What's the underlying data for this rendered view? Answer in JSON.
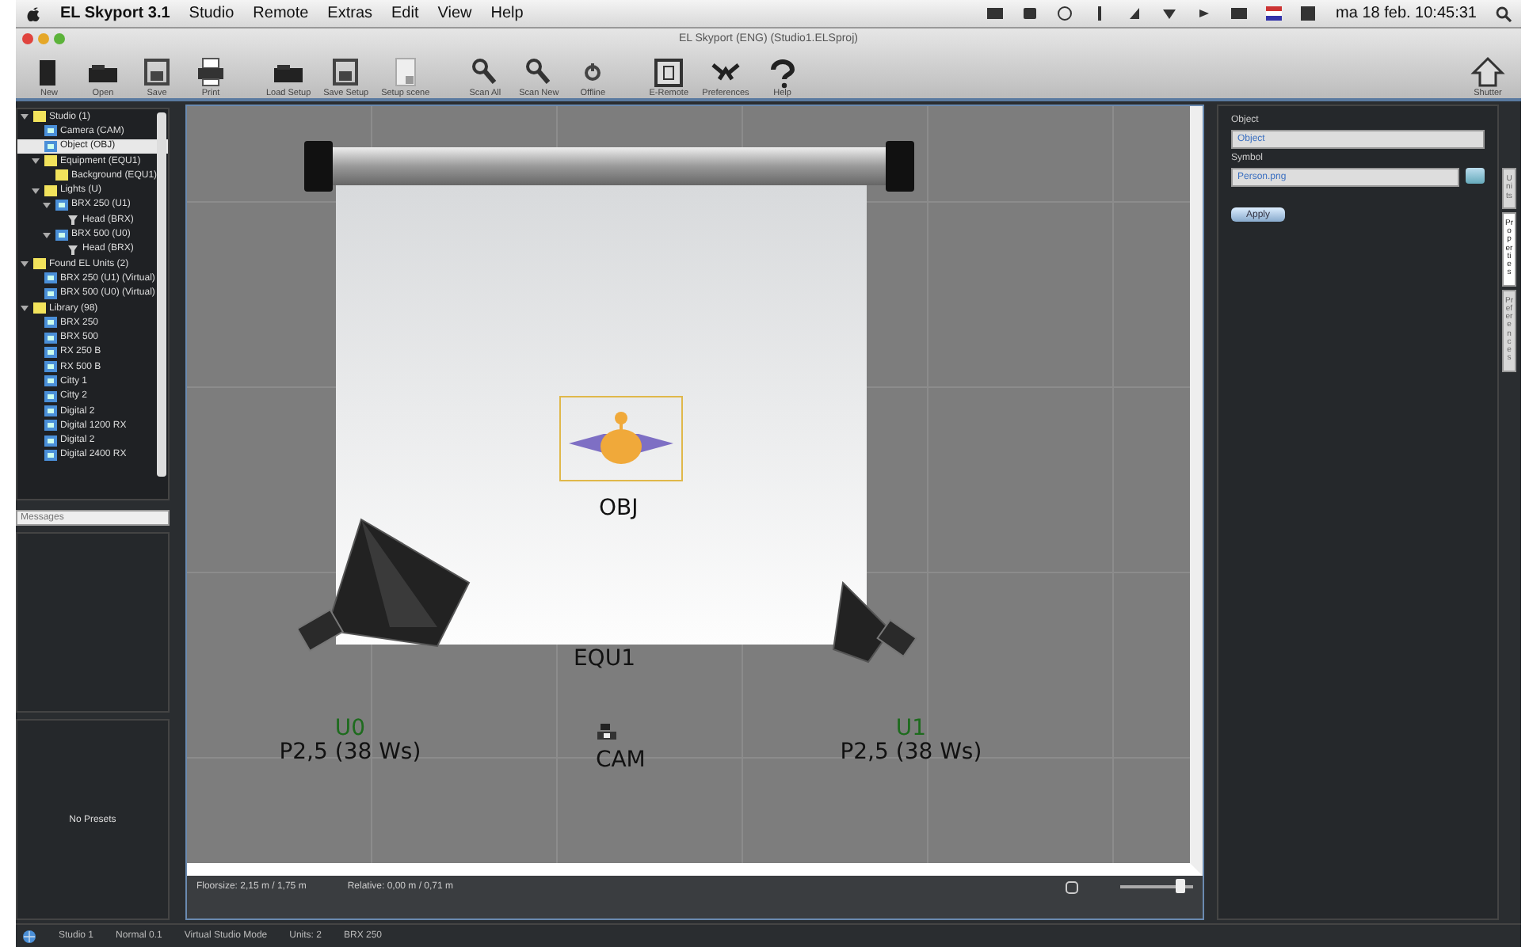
{
  "menu_bar": {
    "items": [
      "EL Skyport 3.1",
      "Studio",
      "Remote",
      "Extras",
      "Edit",
      "View",
      "Help"
    ],
    "clock": "ma 18 feb. 10:45:31"
  },
  "window": {
    "title": "EL Skyport (ENG) (Studio1.ELSproj)"
  },
  "toolbar": {
    "buttons": [
      {
        "label": "New",
        "kind": "new"
      },
      {
        "label": "Open",
        "kind": "open"
      },
      {
        "label": "Save",
        "kind": "save"
      },
      {
        "label": "Print",
        "kind": "print"
      },
      {
        "label": "Load Setup",
        "kind": "open"
      },
      {
        "label": "Save Setup",
        "kind": "save"
      },
      {
        "label": "Setup scene",
        "kind": "scene"
      },
      {
        "label": "Scan All",
        "kind": "scan"
      },
      {
        "label": "Scan New",
        "kind": "scan"
      },
      {
        "label": "Offline",
        "kind": "offline"
      },
      {
        "label": "E-Remote",
        "kind": "remote"
      },
      {
        "label": "Preferences",
        "kind": "prefs"
      },
      {
        "label": "Help",
        "kind": "help"
      }
    ],
    "right_button": {
      "label": "Shutter"
    }
  },
  "tree": [
    {
      "label": "Studio (1)",
      "kind": "folder",
      "selected": false,
      "expanded": true,
      "children": [
        {
          "label": "Camera (CAM)",
          "kind": "unit",
          "selected": false
        },
        {
          "label": "Object (OBJ)",
          "kind": "unit",
          "selected": true
        },
        {
          "label": "Equipment (EQU1)",
          "kind": "folder",
          "selected": false,
          "expanded": true,
          "children": [
            {
              "label": "Background (EQU1)",
              "kind": "folder",
              "selected": false
            }
          ]
        },
        {
          "label": "Lights (U)",
          "kind": "folder",
          "selected": false,
          "expanded": true,
          "children": [
            {
              "label": "BRX 250 (U1)",
              "kind": "unit",
              "selected": false,
              "expanded": true,
              "children": [
                {
                  "label": "Head (BRX)",
                  "kind": "head",
                  "selected": false
                }
              ]
            },
            {
              "label": "BRX 500 (U0)",
              "kind": "unit",
              "selected": false,
              "expanded": true,
              "children": [
                {
                  "label": "Head (BRX)",
                  "kind": "head",
                  "selected": false
                }
              ]
            }
          ]
        }
      ]
    },
    {
      "label": "Found EL Units (2)",
      "kind": "folder",
      "selected": false,
      "expanded": true,
      "children": [
        {
          "label": "BRX 250 (U1) (Virtual)",
          "kind": "unit",
          "selected": false
        },
        {
          "label": "BRX 500 (U0) (Virtual)",
          "kind": "unit",
          "selected": false
        }
      ]
    },
    {
      "label": "Library (98)",
      "kind": "folder",
      "selected": false,
      "expanded": true,
      "children": [
        {
          "label": "BRX 250",
          "kind": "unit",
          "selected": false
        },
        {
          "label": "BRX 500",
          "kind": "unit",
          "selected": false
        },
        {
          "label": "RX 250 B",
          "kind": "unit",
          "selected": false
        },
        {
          "label": "RX 500 B",
          "kind": "unit",
          "selected": false
        },
        {
          "label": "Citty 1",
          "kind": "unit",
          "selected": false
        },
        {
          "label": "Citty 2",
          "kind": "unit",
          "selected": false
        },
        {
          "label": "Digital 2",
          "kind": "unit",
          "selected": false
        },
        {
          "label": "Digital 1200 RX",
          "kind": "unit",
          "selected": false
        },
        {
          "label": "Digital 2",
          "kind": "unit",
          "selected": false
        },
        {
          "label": "Digital 2400 RX",
          "kind": "unit",
          "selected": false
        }
      ]
    }
  ],
  "messages": {
    "placeholder": "Messages"
  },
  "presets": {
    "empty_text": "No Presets"
  },
  "canvas": {
    "object": {
      "label": "OBJ"
    },
    "background": {
      "label": "EQU1"
    },
    "camera": {
      "label": "CAM"
    },
    "lights": [
      {
        "unit": "U0",
        "power": "P2,5 (38 Ws)",
        "kind": "softbox",
        "color": "#1e6b1e"
      },
      {
        "unit": "U1",
        "power": "P2,5 (38 Ws)",
        "kind": "reflector",
        "color": "#1e6b1e"
      }
    ],
    "floorsize": "Floorsize: 2,15 m / 1,75 m",
    "relative": "Relative: 0,00 m / 0,71 m",
    "zoom": {
      "level": 0.82
    }
  },
  "properties": {
    "object_label": "Object",
    "object_value": "Object",
    "symbol_label": "Symbol",
    "symbol_value": "Person.png",
    "apply_button": "Apply"
  },
  "side_tabs": [
    {
      "label": "Units",
      "selected": false
    },
    {
      "label": "Properties",
      "selected": true
    },
    {
      "label": "Preferences",
      "selected": false
    }
  ],
  "status_bar": [
    "Studio 1",
    "Normal 0.1",
    "Virtual Studio Mode",
    "Units: 2",
    "BRX 250"
  ]
}
